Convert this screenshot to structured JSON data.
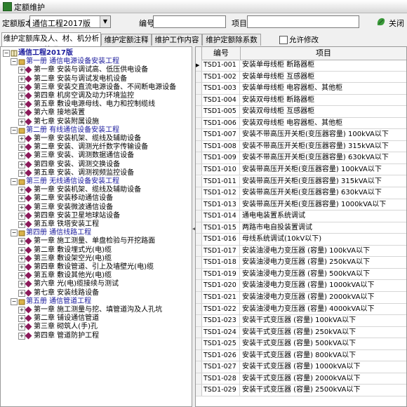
{
  "window": {
    "title": "定额维护",
    "accent": "#2d7f2d"
  },
  "toolbar": {
    "version_label": "定额版本",
    "version_value": "通信工程2017版",
    "code_label": "编号",
    "code_value": "",
    "item_label": "项目",
    "item_value": "",
    "close_label": "关闭"
  },
  "tabs": [
    {
      "label": "维护定额库及人、材、机分析处理"
    },
    {
      "label": "维护定额注释"
    },
    {
      "label": "维护工作内容"
    },
    {
      "label": "维护定额除系数"
    }
  ],
  "allow_edit": {
    "label": "允许修改",
    "checked": false
  },
  "tree": {
    "root": "通信工程2017版",
    "volumes": [
      {
        "label": "第一册 通信电源设备安装工程",
        "chapters": [
          "第一章 安装与调试高、低压供电设备",
          "第二章 安装与调试发电机设备",
          "第三章 安装交直流电源设备、不间断电源设备",
          "第四章 机房空调及动力环境监控",
          "第五章 敷设电源母线、电力和控制缆线",
          "第六章 接地装置",
          "第七章 安装附属设施"
        ]
      },
      {
        "label": "第二册 有线通信设备安装工程",
        "chapters": [
          "第一章 安装机架、缆线及辅助设备",
          "第二章 安装、调测光纤数字传输设备",
          "第三章 安装、调测数据通信设备",
          "第四章 安装、调测交换设备",
          "第五章 安装、调测视频监控设备"
        ]
      },
      {
        "label": "第三册 无线通信设备安装工程",
        "chapters": [
          "第一章 安装机架、缆线及辅助设备",
          "第二章 安装移动通信设备",
          "第三章 安装微波通信设备",
          "第四章 安装卫星地球站设备",
          "第五章 铁塔安装工程"
        ]
      },
      {
        "label": "第四册 通信线路工程",
        "chapters": [
          "第一章 施工测量、单盘检验与开挖路面",
          "第二章 敷设埋式光(电)缆",
          "第三章 敷设架空光(电)缆",
          "第四章 敷设管道、引上及墙壁光(电)缆",
          "第五章 敷设其他光(电)缆",
          "第六章 光(电)缆接续与测试",
          "第七章 安装线路设备"
        ]
      },
      {
        "label": "第五册 通信管道工程",
        "chapters": [
          "第一章 施工测量与挖、填管道沟及人孔坑",
          "第二章 铺设通信管道",
          "第三章 砌筑人(手)孔",
          "第四章 管道防护工程"
        ]
      }
    ]
  },
  "grid": {
    "headers": {
      "code": "编号",
      "item": "项目"
    },
    "rows": [
      {
        "code": "TSD1-001",
        "item": "安装单母线柜 断路器柜"
      },
      {
        "code": "TSD1-002",
        "item": "安装单母线柜 互感器柜"
      },
      {
        "code": "TSD1-003",
        "item": "安装单母线柜 电容器柜、其他柜"
      },
      {
        "code": "TSD1-004",
        "item": "安装双母线柜 断路器柜"
      },
      {
        "code": "TSD1-005",
        "item": "安装双母线柜 互感器柜"
      },
      {
        "code": "TSD1-006",
        "item": "安装双母线柜 电容器柜、其他柜"
      },
      {
        "code": "TSD1-007",
        "item": "安装不带高压开关柜(变压器容量) 100kVA以下"
      },
      {
        "code": "TSD1-008",
        "item": "安装不带高压开关柜(变压器容量) 315kVA以下"
      },
      {
        "code": "TSD1-009",
        "item": "安装不带高压开关柜(变压器容量) 630kVA以下"
      },
      {
        "code": "TSD1-010",
        "item": "安装带高压开关柜(变压器容量) 100kVA以下"
      },
      {
        "code": "TSD1-011",
        "item": "安装带高压开关柜(变压器容量) 315kVA以下"
      },
      {
        "code": "TSD1-012",
        "item": "安装带高压开关柜(变压器容量) 630kVA以下"
      },
      {
        "code": "TSD1-013",
        "item": "安装带高压开关柜(变压器容量) 1000kVA以下"
      },
      {
        "code": "TSD1-014",
        "item": "通电电装置系统调试"
      },
      {
        "code": "TSD1-015",
        "item": "两路市电自投装置调试"
      },
      {
        "code": "TSD1-016",
        "item": "母线系统调试(10kV以下)"
      },
      {
        "code": "TSD1-017",
        "item": "安装油浸电力变压器 (容量) 100kVA以下"
      },
      {
        "code": "TSD1-018",
        "item": "安装油浸电力变压器 (容量) 250kVA以下"
      },
      {
        "code": "TSD1-019",
        "item": "安装油浸电力变压器 (容量) 500kVA以下"
      },
      {
        "code": "TSD1-020",
        "item": "安装油浸电力变压器 (容量) 1000kVA以下"
      },
      {
        "code": "TSD1-021",
        "item": "安装油浸电力变压器 (容量) 2000kVA以下"
      },
      {
        "code": "TSD1-022",
        "item": "安装油浸电力变压器 (容量) 4000kVA以下"
      },
      {
        "code": "TSD1-023",
        "item": "安装干式变压器 (容量) 100kVA以下"
      },
      {
        "code": "TSD1-024",
        "item": "安装干式变压器 (容量) 250kVA以下"
      },
      {
        "code": "TSD1-025",
        "item": "安装干式变压器 (容量) 500kVA以下"
      },
      {
        "code": "TSD1-026",
        "item": "安装干式变压器 (容量) 800kVA以下"
      },
      {
        "code": "TSD1-027",
        "item": "安装干式变压器 (容量) 1000kVA以下"
      },
      {
        "code": "TSD1-028",
        "item": "安装干式变压器 (容量) 2000kVA以下"
      },
      {
        "code": "TSD1-029",
        "item": "安装干式变压器 (容量) 2500kVA以下"
      }
    ]
  }
}
